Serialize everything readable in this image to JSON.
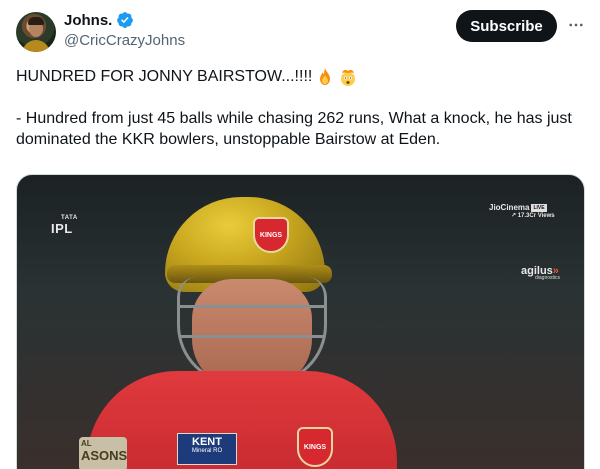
{
  "author": {
    "display_name": "Johns.",
    "handle": "@CricCrazyJohns",
    "verified": true
  },
  "actions": {
    "subscribe_label": "Subscribe",
    "more_icon": "ellipsis-icon"
  },
  "tweet": {
    "headline": "HUNDRED FOR JONNY BAIRSTOW...!!!!",
    "headline_emojis": [
      "fire-emoji",
      "exploding-head-emoji"
    ],
    "body": "- Hundred from just 45 balls while chasing 262 runs, What a knock, he has just dominated the KKR bowlers, unstoppable Bairstow at Eden."
  },
  "media": {
    "broadcast_logo_top": "TATA",
    "broadcast_logo": "IPL",
    "stream_provider": "JioCinema",
    "live_badge": "LIVE",
    "view_count": "17.3Cr Views",
    "sponsor": "agilus",
    "sponsor_sub": "diagnostics",
    "helmet_badge": "KINGS",
    "jersey_sponsor": "KENT",
    "jersey_sponsor_sub": "Mineral RO",
    "jersey_badge": "KINGS",
    "banner_top": "AL",
    "banner_text": "ASONS"
  },
  "colors": {
    "subscribe_bg": "#0f1419",
    "verified_blue": "#1d9bf0",
    "handle_gray": "#536471"
  }
}
